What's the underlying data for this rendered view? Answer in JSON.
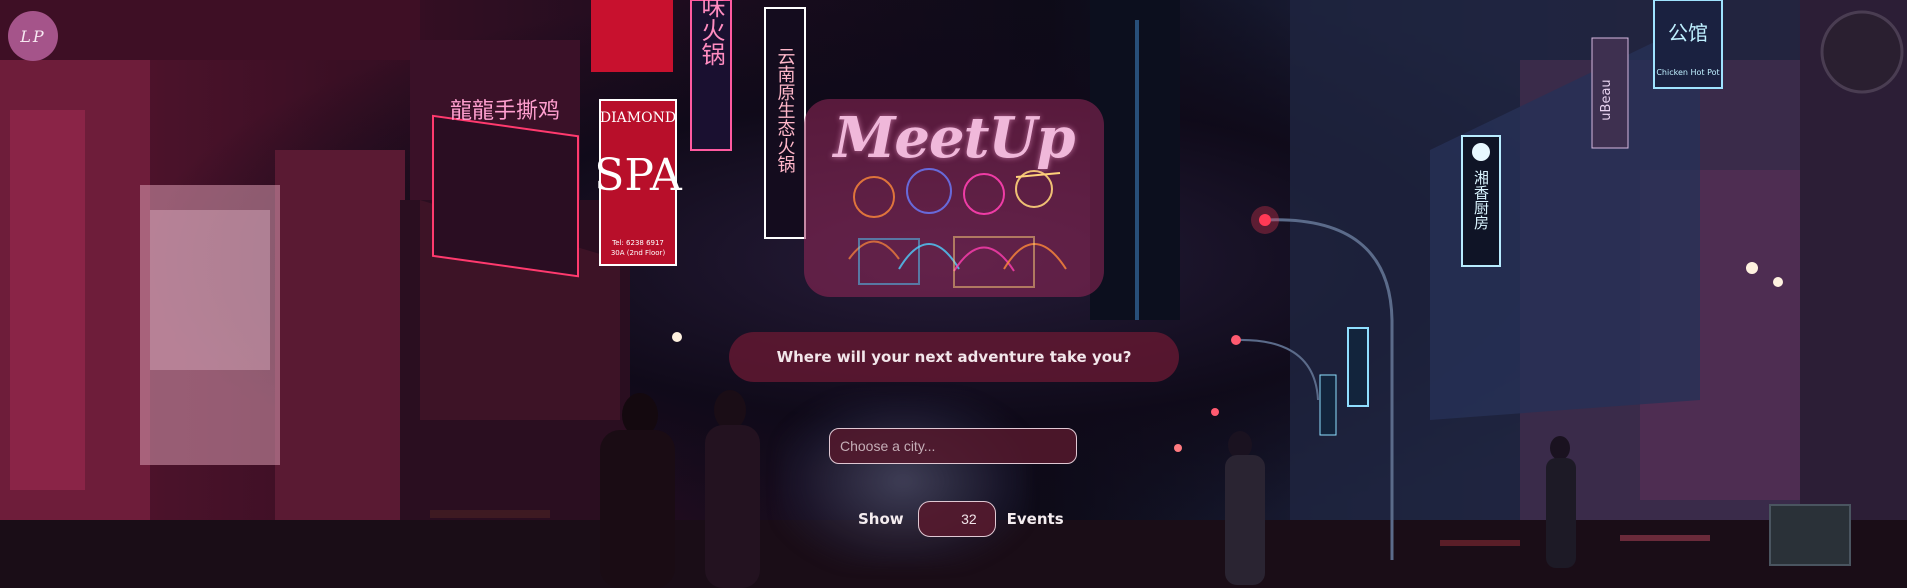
{
  "header": {
    "avatar_text": "LP"
  },
  "brand": {
    "title": "MeetUp"
  },
  "question": {
    "text": "Where will your next adventure take you?"
  },
  "search": {
    "placeholder": "Choose a city..."
  },
  "events_control": {
    "show_label": "Show",
    "count": "32",
    "events_label": "Events"
  },
  "signs": {
    "diamond": "DIAMOND",
    "spa": "SPA",
    "spa_detail_1": "Tel: 6238 6917",
    "spa_detail_2": "30A (2nd Floor)",
    "vertical_1": "味火锅",
    "vertical_2": "云南原生态火锅",
    "right_sign_1": "湘香厨房",
    "right_sign_2": "公馆",
    "right_sign_3": "Chicken Hot Pot",
    "left_shopfront": "龍龍手撕鸡",
    "bracket_sign": "uBeau"
  },
  "colors": {
    "accent_pink": "#a5548a",
    "neon_red": "#ff3a55",
    "neon_cyan": "#7fdcff"
  }
}
